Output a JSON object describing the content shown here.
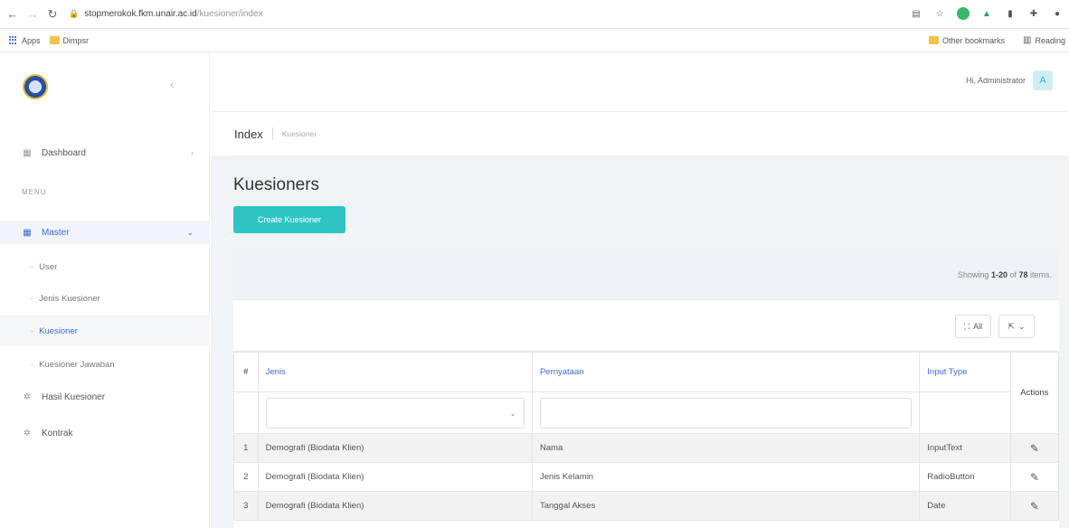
{
  "browser": {
    "url_host": "stopmerokok.fkm.unair.ac.id",
    "url_path": "/kuesioner/index",
    "bookmarks": {
      "apps": "Apps",
      "folder": "Dimpsr",
      "other": "Other bookmarks",
      "reading": "Reading"
    }
  },
  "sidebar": {
    "collapse_glyph": "‹",
    "dashboard": "Dashboard",
    "menu_heading": "MENU",
    "master": "Master",
    "sub_items": [
      "User",
      "Jenis Kuesioner",
      "Kuesioner",
      "Kuesioner Jawaban"
    ],
    "hasil": "Hasil Kuesioner",
    "kontrak": "Kontrak"
  },
  "header": {
    "greeting": "Hi, Administrator",
    "avatar_initial": "A"
  },
  "breadcrumb": {
    "title": "Index",
    "sub": "Kuesioner"
  },
  "page": {
    "title": "Kuesioners",
    "create_button": "Create Kuesioner"
  },
  "summary": {
    "prefix": "Showing ",
    "range": "1-20",
    "of": " of ",
    "total": "78",
    "suffix": " items."
  },
  "toolbar": {
    "all_label": "All"
  },
  "table": {
    "headers": {
      "num": "#",
      "jenis": "Jenis",
      "pernyataan": "Pernyataan",
      "input_type": "Input Type",
      "actions": "Actions"
    },
    "rows": [
      {
        "num": "1",
        "jenis": "Demografi (Biodata Klien)",
        "pernyataan": "Nama",
        "input_type": "InputText"
      },
      {
        "num": "2",
        "jenis": "Demografi (Biodata Klien)",
        "pernyataan": "Jenis Kelamin",
        "input_type": "RadioButton"
      },
      {
        "num": "3",
        "jenis": "Demografi (Biodata Klien)",
        "pernyataan": "Tanggal Akses",
        "input_type": "Date"
      }
    ]
  },
  "colors": {
    "accent": "#3f6ad8",
    "create_button": "#2fc4c4",
    "content_bg": "#f1f4f6"
  },
  "icons": [
    "back-icon",
    "forward-icon",
    "reload-icon",
    "lock-icon",
    "dashboard-icon",
    "master-icon",
    "hasil-icon",
    "kontrak-icon",
    "expand-icon",
    "export-icon",
    "edit-icon"
  ]
}
